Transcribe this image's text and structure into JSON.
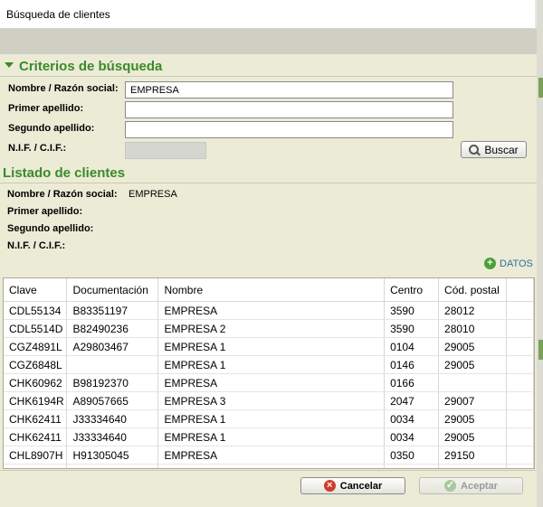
{
  "window": {
    "title": "Búsqueda de clientes"
  },
  "criteria": {
    "title": "Criterios de búsqueda",
    "nombre_label": "Nombre / Razón social:",
    "nombre_value": "EMPRESA",
    "primer_label": "Primer apellido:",
    "primer_value": "",
    "segundo_label": "Segundo apellido:",
    "segundo_value": "",
    "nif_label": "N.I.F. / C.I.F.:",
    "nif_value": "",
    "buscar_label": "Buscar"
  },
  "listado": {
    "title": "Listado de clientes",
    "nombre_label": "Nombre / Razón social:",
    "nombre_value": "EMPRESA",
    "primer_label": "Primer apellido:",
    "segundo_label": "Segundo apellido:",
    "nif_label": "N.I.F. / C.I.F.:",
    "datos_label": "DATOS"
  },
  "table": {
    "headers": [
      "Clave",
      "Documentación",
      "Nombre",
      "Centro",
      "Cód. postal"
    ],
    "rows": [
      [
        "CDL55134",
        "B83351197",
        " EMPRESA",
        "3590",
        "28012"
      ],
      [
        "CDL5514D",
        "B82490236",
        "EMPRESA 2",
        "3590",
        "28010"
      ],
      [
        "CGZ4891L",
        "A29803467",
        "EMPRESA 1",
        "0104",
        "29005"
      ],
      [
        "CGZ6848L",
        "",
        "EMPRESA 1",
        "0146",
        "29005"
      ],
      [
        "CHK60962",
        "B98192370",
        "EMPRESA",
        "0166",
        ""
      ],
      [
        "CHK6194R",
        "A89057665",
        "EMPRESA 3",
        "2047",
        "29007"
      ],
      [
        "CHK62411",
        "J33334640",
        "EMPRESA 1",
        "0034",
        "29005"
      ],
      [
        "CHK62411",
        "J33334640",
        " EMPRESA 1",
        "0034",
        "29005"
      ],
      [
        "CHL8907H",
        "H91305045",
        "EMPRESA",
        "0350",
        "29150"
      ]
    ]
  },
  "footer": {
    "cancel_label": "Cancelar",
    "accept_label": "Aceptar"
  },
  "colors": {
    "section_green": "#3a8a2a",
    "panel_bg": "#ecebd6"
  }
}
